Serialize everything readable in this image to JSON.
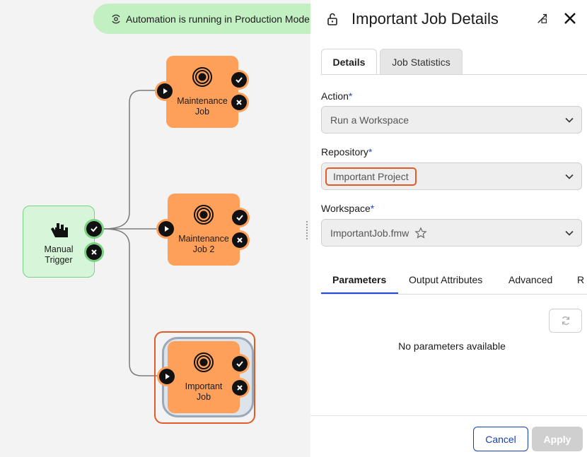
{
  "banner": {
    "text": "Automation is running in Production Mode"
  },
  "nodes": {
    "trigger": {
      "label": "Manual Trigger"
    },
    "job1": {
      "label": "Maintenance Job"
    },
    "job2": {
      "label": "Maintenance Job 2"
    },
    "job3": {
      "label": "Important Job"
    }
  },
  "panel": {
    "title": "Important Job Details",
    "tabs": [
      "Details",
      "Job Statistics"
    ],
    "action": {
      "label": "Action",
      "value": "Run a Workspace"
    },
    "repository": {
      "label": "Repository",
      "value": "Important Project"
    },
    "workspace": {
      "label": "Workspace",
      "value": "ImportantJob.fmw"
    },
    "required_mark": "*",
    "sub_tabs": [
      "Parameters",
      "Output Attributes",
      "Advanced",
      "R"
    ],
    "empty_message": "No parameters available",
    "cancel_label": "Cancel",
    "apply_label": "Apply"
  },
  "colors": {
    "job_node": "#ffa05a",
    "trigger_node": "#d6f5d9",
    "selection": "#e25a26",
    "accent": "#1e4bd2",
    "banner": "#c3f0c2"
  }
}
